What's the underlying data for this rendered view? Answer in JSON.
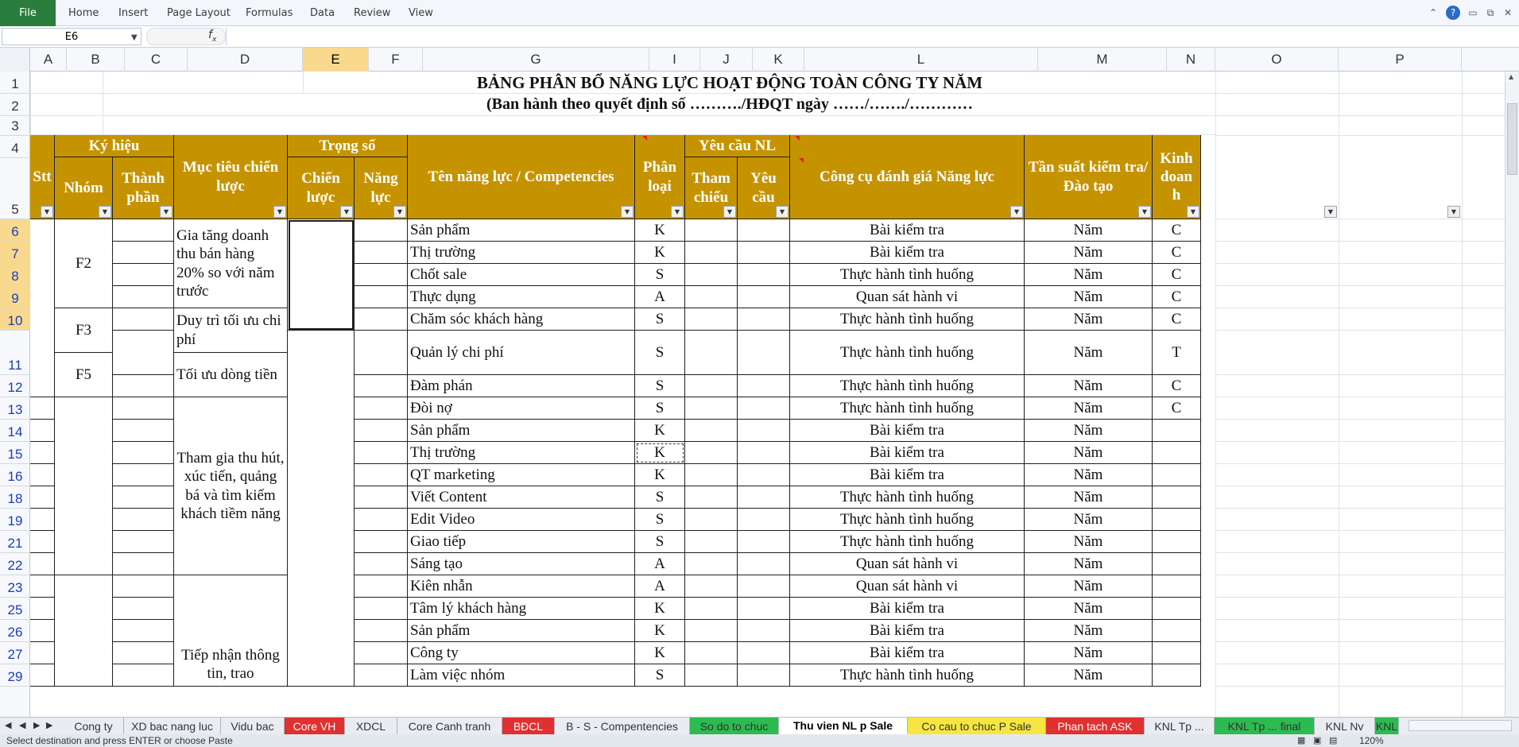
{
  "ribbon": {
    "file": "File",
    "tabs": [
      "Home",
      "Insert",
      "Page Layout",
      "Formulas",
      "Data",
      "Review",
      "View"
    ]
  },
  "formula_bar": {
    "name_box": "E6",
    "fx_symbol": "fx",
    "formula": ""
  },
  "columns": [
    "A",
    "B",
    "C",
    "D",
    "E",
    "F",
    "G",
    "I",
    "J",
    "K",
    "L",
    "M",
    "N",
    "O",
    "P"
  ],
  "selected_column": "E",
  "title": {
    "line1": "BẢNG PHÂN BỔ NĂNG LỰC HOẠT ĐỘNG TOÀN CÔNG TY NĂM",
    "line2": "(Ban hành theo quyết định số ………./HĐQT ngày ……/……./…………"
  },
  "headers": {
    "ky_hieu": "Ký hiệu",
    "trong_so": "Trọng số",
    "yeu_cau_nl": "Yêu cầu NL",
    "stt": "Stt",
    "nhom": "Nhóm",
    "thanh_phan": "Thành phần",
    "muc_tieu": "Mục tiêu chiến lược",
    "chien_luoc": "Chiến lược",
    "nang_luc": "Năng lực",
    "ten_nang_luc": "Tên năng lực / Competencies",
    "phan_loai": "Phân loại",
    "tham_chieu": "Tham chiếu",
    "yeu_cau": "Yêu cầu",
    "cong_cu": "Công cụ đánh giá Năng lực",
    "tan_suat": "Tần suất kiểm tra/ Đào tạo",
    "kinh_doanh": "Kinh doan h"
  },
  "row_numbers": [
    "1",
    "2",
    "3",
    "4",
    "5",
    "6",
    "7",
    "8",
    "9",
    "10",
    "11",
    "12",
    "13",
    "14",
    "15",
    "16",
    "18",
    "19",
    "21",
    "22",
    "23",
    "25",
    "26",
    "27",
    "29"
  ],
  "groups": [
    {
      "nhom": "F2",
      "muc_tieu": "Gia tăng doanh thu bán hàng 20% so với năm trước"
    },
    {
      "nhom": "F3",
      "muc_tieu": "Duy trì tối ưu chi phí"
    },
    {
      "nhom": "F5",
      "muc_tieu": "Tối ưu dòng tiền"
    },
    {
      "nhom": "",
      "muc_tieu": "Tham gia thu hút, xúc tiến, quảng bá và tìm kiếm khách tiềm năng"
    },
    {
      "nhom": "",
      "muc_tieu": "Tiếp nhận thông tin, trao"
    }
  ],
  "rows": [
    {
      "row": "6",
      "name": "Sản phẩm",
      "type": "K",
      "tool": "Bài kiểm tra",
      "freq": "Năm",
      "kd": "C"
    },
    {
      "row": "7",
      "name": "Thị trường",
      "type": "K",
      "tool": "Bài kiểm tra",
      "freq": "Năm",
      "kd": "C"
    },
    {
      "row": "8",
      "name": "Chốt sale",
      "type": "S",
      "tool": "Thực hành tình huống",
      "freq": "Năm",
      "kd": "C"
    },
    {
      "row": "9",
      "name": "Thực dụng",
      "type": "A",
      "tool": "Quan sát hành vi",
      "freq": "Năm",
      "kd": "C"
    },
    {
      "row": "10",
      "name": "Chăm sóc khách hàng",
      "type": "S",
      "tool": "Thực hành tình huống",
      "freq": "Năm",
      "kd": "C"
    },
    {
      "row": "11",
      "name": "Quản lý chi phí",
      "type": "S",
      "tool": "Thực hành tình huống",
      "freq": "Năm",
      "kd": "T"
    },
    {
      "row": "12",
      "name": "Đàm phán",
      "type": "S",
      "tool": "Thực hành tình huống",
      "freq": "Năm",
      "kd": "C"
    },
    {
      "row": "13",
      "name": "Đòi nợ",
      "type": "S",
      "tool": "Thực hành tình huống",
      "freq": "Năm",
      "kd": "C"
    },
    {
      "row": "14",
      "name": "Sản phẩm",
      "type": "K",
      "tool": "Bài kiểm tra",
      "freq": "Năm",
      "kd": ""
    },
    {
      "row": "15",
      "name": "Thị trường",
      "type": "K",
      "tool": "Bài kiểm tra",
      "freq": "Năm",
      "kd": ""
    },
    {
      "row": "16",
      "name": "QT marketing",
      "type": "K",
      "tool": "Bài kiểm tra",
      "freq": "Năm",
      "kd": ""
    },
    {
      "row": "18",
      "name": "Viết Content",
      "type": "S",
      "tool": "Thực hành tình huống",
      "freq": "Năm",
      "kd": ""
    },
    {
      "row": "19",
      "name": "Edit Video",
      "type": "S",
      "tool": "Thực hành tình huống",
      "freq": "Năm",
      "kd": ""
    },
    {
      "row": "21",
      "name": "Giao tiếp",
      "type": "S",
      "tool": "Thực hành tình huống",
      "freq": "Năm",
      "kd": ""
    },
    {
      "row": "22",
      "name": "Sáng tạo",
      "type": "A",
      "tool": "Quan sát hành vi",
      "freq": "Năm",
      "kd": ""
    },
    {
      "row": "23",
      "name": "Kiên nhẫn",
      "type": "A",
      "tool": "Quan sát hành vi",
      "freq": "Năm",
      "kd": ""
    },
    {
      "row": "25",
      "name": "Tâm lý khách hàng",
      "type": "K",
      "tool": "Bài kiểm tra",
      "freq": "Năm",
      "kd": ""
    },
    {
      "row": "26",
      "name": "Sản phẩm",
      "type": "K",
      "tool": "Bài kiểm tra",
      "freq": "Năm",
      "kd": ""
    },
    {
      "row": "27",
      "name": "Công ty",
      "type": "K",
      "tool": "Bài kiểm tra",
      "freq": "Năm",
      "kd": ""
    },
    {
      "row": "29",
      "name": "Làm việc nhóm",
      "type": "S",
      "tool": "Thực hành tình huống",
      "freq": "Năm",
      "kd": ""
    }
  ],
  "sheet_tabs": [
    {
      "label": "Cong ty",
      "color": ""
    },
    {
      "label": "XD bac nang luc",
      "color": ""
    },
    {
      "label": "Vidu bac",
      "color": ""
    },
    {
      "label": "Core VH",
      "color": "#e03030"
    },
    {
      "label": "XDCL",
      "color": ""
    },
    {
      "label": "Core Canh tranh",
      "color": ""
    },
    {
      "label": "BĐCL",
      "color": "#e03030"
    },
    {
      "label": "B - S - Compentencies",
      "color": ""
    },
    {
      "label": "So do to chuc",
      "color": "#2dbb4f"
    },
    {
      "label": "Thu vien NL p Sale",
      "color": ""
    },
    {
      "label": "Co cau to chuc P Sale",
      "color": "#f5e642"
    },
    {
      "label": "Phan tach ASK",
      "color": "#e03030"
    },
    {
      "label": "KNL Tp ...",
      "color": ""
    },
    {
      "label": "KNL Tp ... final",
      "color": "#2dbb4f"
    },
    {
      "label": "KNL Nv",
      "color": ""
    },
    {
      "label": "KNL",
      "color": "#2dbb4f"
    }
  ],
  "active_tab": "Thu vien NL p Sale",
  "status": {
    "message": "Select destination and press ENTER or choose Paste",
    "zoom": "120%"
  },
  "colors": {
    "header_fill": "#c69300",
    "file_tab": "#2a7d3c",
    "selection": "#f9d98e"
  }
}
